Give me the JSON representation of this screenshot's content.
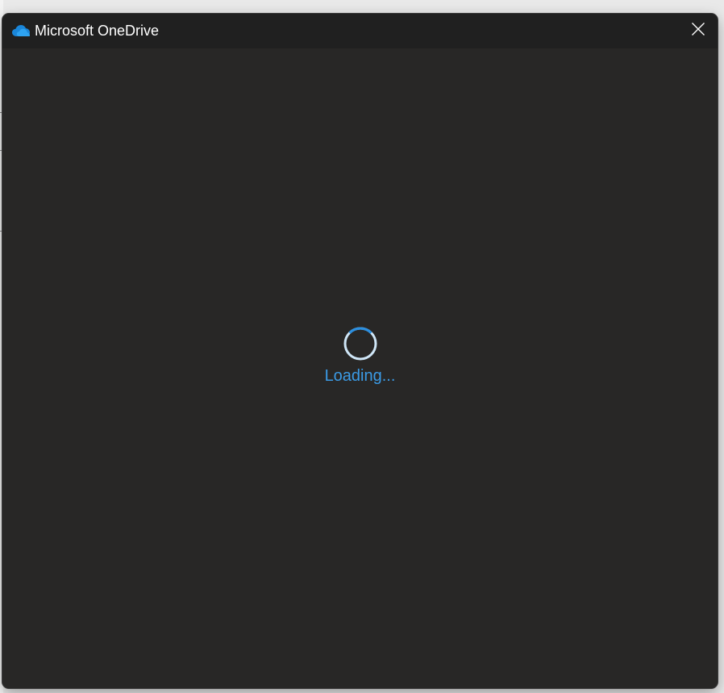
{
  "window": {
    "title": "Microsoft OneDrive",
    "app_icon": "onedrive-cloud-icon",
    "close_icon": "close-icon"
  },
  "content": {
    "status_text": "Loading...",
    "spinner_icon": "loading-spinner-icon"
  },
  "colors": {
    "accent": "#3b9be6",
    "window_bg": "#282726",
    "titlebar_bg": "#202020",
    "title_text": "#ffffff"
  }
}
